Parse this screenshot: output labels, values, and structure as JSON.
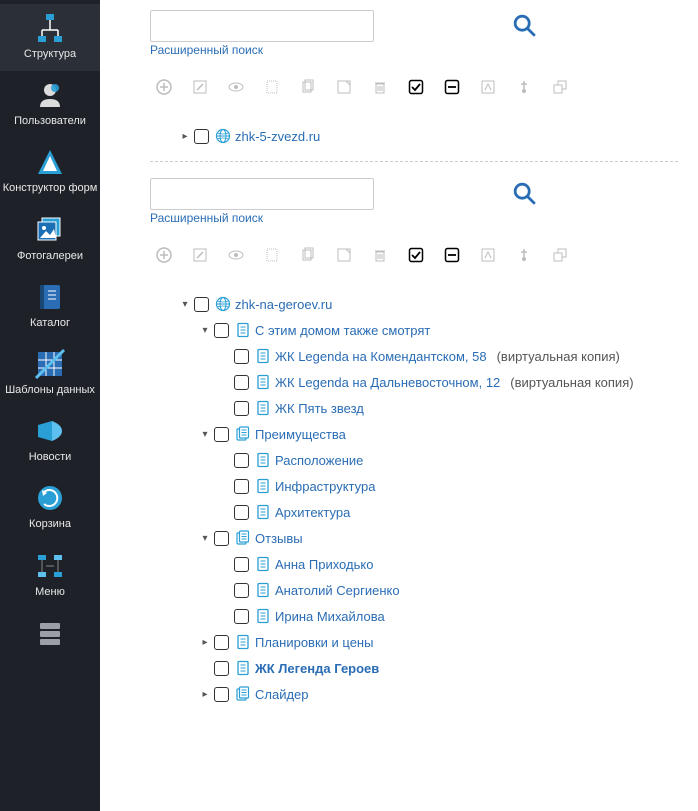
{
  "sidebar": {
    "items": [
      {
        "label": "Структура"
      },
      {
        "label": "Пользователи"
      },
      {
        "label": "Конструктор форм"
      },
      {
        "label": "Фотогалереи"
      },
      {
        "label": "Каталог"
      },
      {
        "label": "Шаблоны данных"
      },
      {
        "label": "Новости"
      },
      {
        "label": "Корзина"
      },
      {
        "label": "Меню"
      }
    ]
  },
  "sections": [
    {
      "search_placeholder": "",
      "adv_search_label": "Расширенный поиск",
      "tree": [
        {
          "label": "zhk-5-zvezd.ru",
          "icon": "globe",
          "arrow": "right",
          "indent": 0
        }
      ]
    },
    {
      "search_placeholder": "",
      "adv_search_label": "Расширенный поиск",
      "tree": [
        {
          "label": "zhk-na-geroev.ru",
          "icon": "globe",
          "arrow": "down",
          "indent": 0
        },
        {
          "label": "С этим домом также смотрят",
          "icon": "page",
          "arrow": "down",
          "indent": 1
        },
        {
          "label": "ЖК Legenda на Комендантском, 58",
          "icon": "page",
          "arrow": "",
          "indent": 2,
          "suffix": "(виртуальная копия)"
        },
        {
          "label": "ЖК Legenda на Дальневосточном, 12",
          "icon": "page",
          "arrow": "",
          "indent": 2,
          "suffix": "(виртуальная копия)"
        },
        {
          "label": "ЖК Пять звезд",
          "icon": "page",
          "arrow": "",
          "indent": 2
        },
        {
          "label": "Преимущества",
          "icon": "stack",
          "arrow": "down",
          "indent": 1
        },
        {
          "label": "Расположение",
          "icon": "page",
          "arrow": "",
          "indent": 2
        },
        {
          "label": "Инфраструктура",
          "icon": "page",
          "arrow": "",
          "indent": 2
        },
        {
          "label": "Архитектура",
          "icon": "page",
          "arrow": "",
          "indent": 2
        },
        {
          "label": "Отзывы",
          "icon": "stack",
          "arrow": "down",
          "indent": 1
        },
        {
          "label": "Анна Приходько",
          "icon": "page",
          "arrow": "",
          "indent": 2
        },
        {
          "label": "Анатолий Сергиенко",
          "icon": "page",
          "arrow": "",
          "indent": 2
        },
        {
          "label": "Ирина Михайлова",
          "icon": "page",
          "arrow": "",
          "indent": 2
        },
        {
          "label": "Планировки и цены",
          "icon": "page",
          "arrow": "right",
          "indent": 1
        },
        {
          "label": "ЖК Легенда Героев",
          "icon": "page",
          "arrow": "",
          "indent": 1,
          "bold": true
        },
        {
          "label": "Слайдер",
          "icon": "stack",
          "arrow": "right",
          "indent": 1
        }
      ]
    }
  ]
}
